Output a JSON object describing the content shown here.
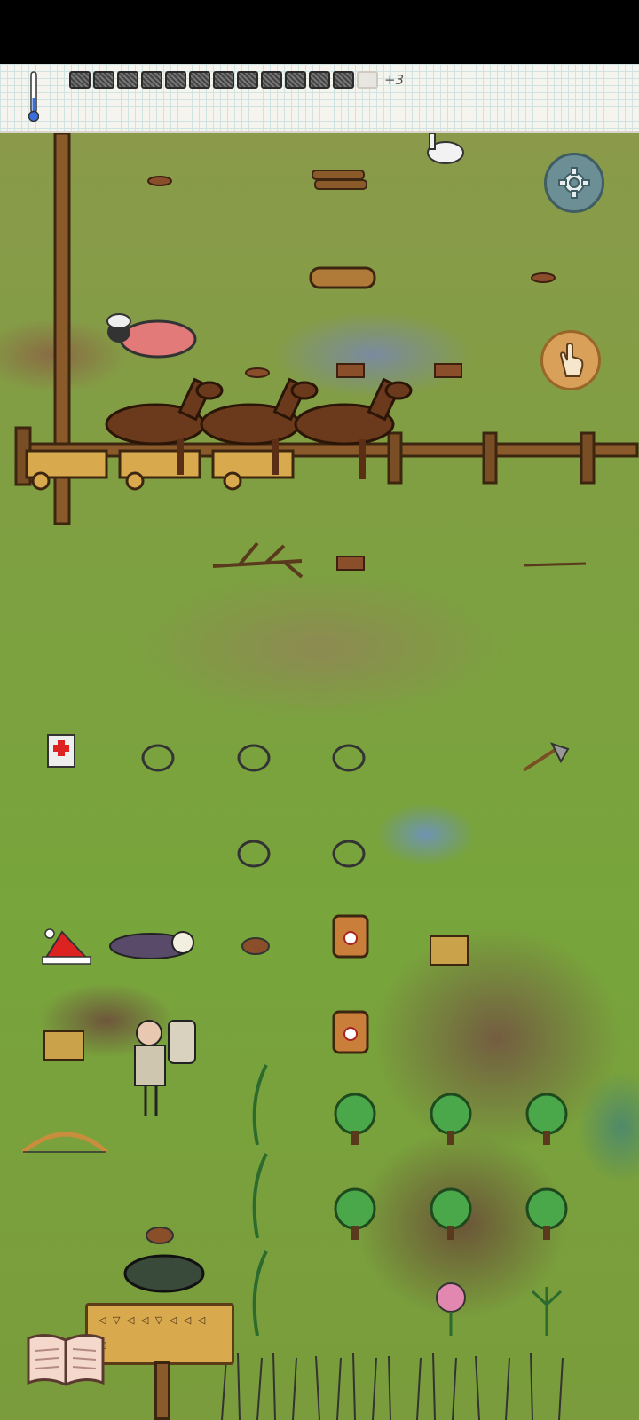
{
  "hud": {
    "food_pips_filled": 12,
    "food_pips_empty": 1,
    "extra_food": "+3",
    "temperature_level": 0.2
  },
  "buttons": {
    "settings_icon": "gear-icon",
    "interact_icon": "hand-icon",
    "tech_book_icon": "book-icon"
  },
  "colors": {
    "settings_button": "#6b8f95",
    "interact_button": "#d9a05a",
    "grass": "#7da040",
    "mud": "#735d40",
    "fence": "#8a5a2b"
  }
}
